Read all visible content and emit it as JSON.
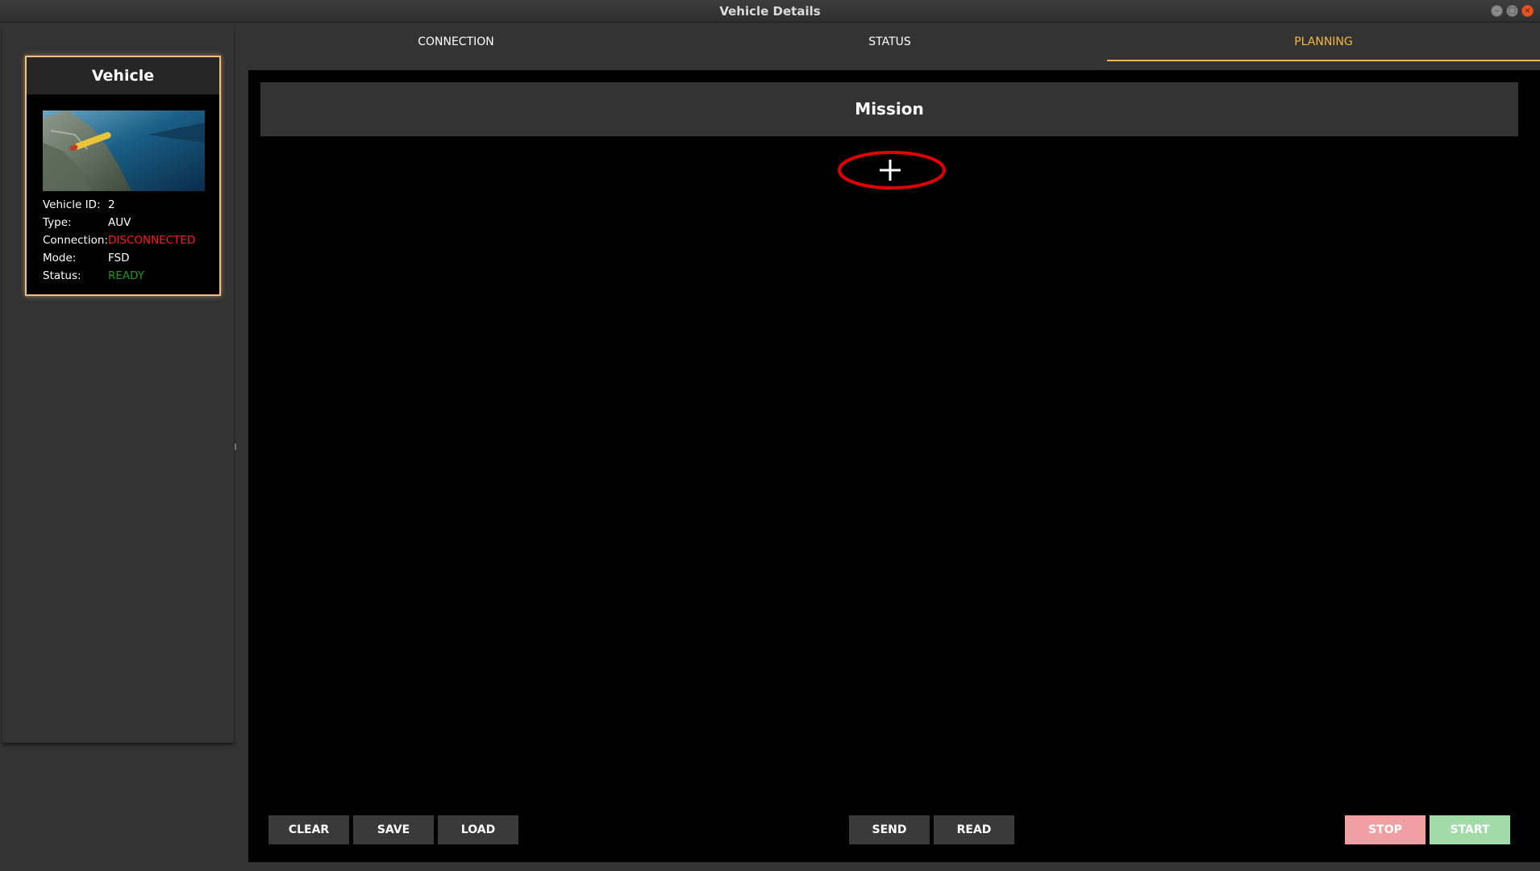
{
  "window": {
    "title": "Vehicle Details"
  },
  "vehicle_card": {
    "heading": "Vehicle",
    "image": "auv-underwater-photo",
    "rows": [
      {
        "label": "Vehicle ID:",
        "value": "2"
      },
      {
        "label": "Type:",
        "value": "AUV"
      },
      {
        "label": "Connection:",
        "value": "DISCONNECTED",
        "color": "#ff1a1a"
      },
      {
        "label": "Mode:",
        "value": "FSD"
      },
      {
        "label": "Status:",
        "value": "READY",
        "color": "#1c9a1c"
      }
    ]
  },
  "tabs": [
    {
      "label": "CONNECTION",
      "active": false
    },
    {
      "label": "STATUS",
      "active": false
    },
    {
      "label": "PLANNING",
      "active": true
    }
  ],
  "mission": {
    "heading": "Mission",
    "add_icon": "plus-icon"
  },
  "buttons": {
    "clear": "CLEAR",
    "save": "SAVE",
    "load": "LOAD",
    "send": "SEND",
    "read": "READ",
    "stop": "STOP",
    "start": "START"
  },
  "colors": {
    "accent": "#f5b942",
    "card_border": "#f0c080",
    "highlight": "#e00000",
    "stop": "#f0a0a3",
    "start": "#a0dba8"
  }
}
